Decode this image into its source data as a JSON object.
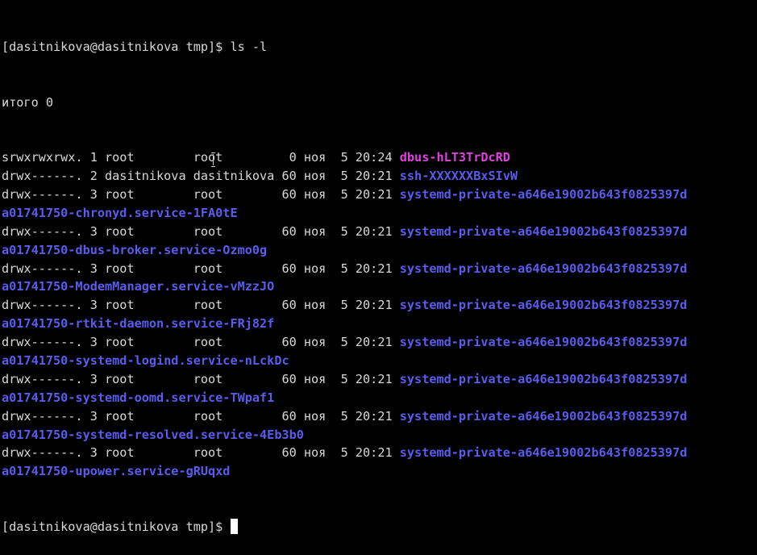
{
  "prompt": "[dasitnikova@dasitnikova tmp]$ ",
  "command": "ls -l",
  "total": "итого 0",
  "entries": [
    {
      "meta": "srwxrwxrwx. 1 root        root         0 ноя  5 20:24 ",
      "name": "dbus-hLT3TrDcRD",
      "kind": "socket",
      "cont": ""
    },
    {
      "meta": "drwx------. 2 dasitnikova dasitnikova 60 ноя  5 20:21 ",
      "name": "ssh-XXXXXXBxSIvW",
      "kind": "dir",
      "cont": ""
    },
    {
      "meta": "drwx------. 3 root        root        60 ноя  5 20:21 ",
      "name": "systemd-private-a646e19002b643f0825397d",
      "kind": "dir",
      "cont": "a01741750-chronyd.service-1FA0tE"
    },
    {
      "meta": "drwx------. 3 root        root        60 ноя  5 20:21 ",
      "name": "systemd-private-a646e19002b643f0825397d",
      "kind": "dir",
      "cont": "a01741750-dbus-broker.service-Ozmo0g"
    },
    {
      "meta": "drwx------. 3 root        root        60 ноя  5 20:21 ",
      "name": "systemd-private-a646e19002b643f0825397d",
      "kind": "dir",
      "cont": "a01741750-ModemManager.service-vMzzJO"
    },
    {
      "meta": "drwx------. 3 root        root        60 ноя  5 20:21 ",
      "name": "systemd-private-a646e19002b643f0825397d",
      "kind": "dir",
      "cont": "a01741750-rtkit-daemon.service-FRj82f"
    },
    {
      "meta": "drwx------. 3 root        root        60 ноя  5 20:21 ",
      "name": "systemd-private-a646e19002b643f0825397d",
      "kind": "dir",
      "cont": "a01741750-systemd-logind.service-nLckDc"
    },
    {
      "meta": "drwx------. 3 root        root        60 ноя  5 20:21 ",
      "name": "systemd-private-a646e19002b643f0825397d",
      "kind": "dir",
      "cont": "a01741750-systemd-oomd.service-TWpaf1"
    },
    {
      "meta": "drwx------. 3 root        root        60 ноя  5 20:21 ",
      "name": "systemd-private-a646e19002b643f0825397d",
      "kind": "dir",
      "cont": "a01741750-systemd-resolved.service-4Eb3b0"
    },
    {
      "meta": "drwx------. 3 root        root        60 ноя  5 20:21 ",
      "name": "systemd-private-a646e19002b643f0825397d",
      "kind": "dir",
      "cont": "a01741750-upower.service-gRUqxd"
    }
  ],
  "colors": {
    "background": "#000000",
    "text": "#d8d8d8",
    "socket": "#e040e0",
    "directory": "#5b5bee",
    "cursor": "#ffffff"
  },
  "icons": {
    "mouse_pointer": "ibeam-cursor-icon"
  }
}
